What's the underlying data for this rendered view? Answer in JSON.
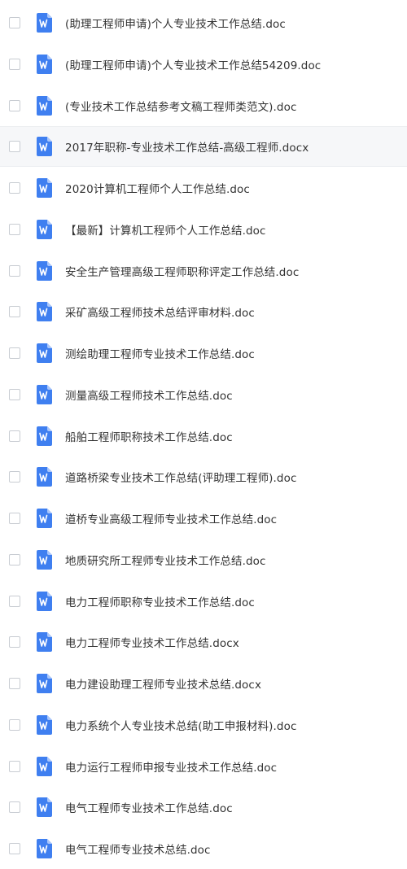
{
  "file_list": {
    "highlighted_index": 3,
    "icon": "word-document-icon",
    "icon_color": "#3f7ff0",
    "items": [
      "(助理工程师申请)个人专业技术工作总结.doc",
      "(助理工程师申请)个人专业技术工作总结54209.doc",
      "(专业技术工作总结参考文稿工程师类范文).doc",
      "2017年职称-专业技术工作总结-高级工程师.docx",
      "2020计算机工程师个人工作总结.doc",
      "【最新】计算机工程师个人工作总结.doc",
      "安全生产管理高级工程师职称评定工作总结.doc",
      "采矿高级工程师技术总结评审材料.doc",
      "测绘助理工程师专业技术工作总结.doc",
      "测量高级工程师技术工作总结.doc",
      "船舶工程师职称技术工作总结.doc",
      "道路桥梁专业技术工作总结(评助理工程师).doc",
      "道桥专业高级工程师专业技术工作总结.doc",
      "地质研究所工程师专业技术工作总结.doc",
      "电力工程师职称专业技术工作总结.doc",
      "电力工程师专业技术工作总结.docx",
      "电力建设助理工程师专业技术总结.docx",
      "电力系统个人专业技术总结(助工申报材料).doc",
      "电力运行工程师申报专业技术工作总结.doc",
      "电气工程师专业技术工作总结.doc",
      "电气工程师专业技术总结.doc"
    ]
  }
}
